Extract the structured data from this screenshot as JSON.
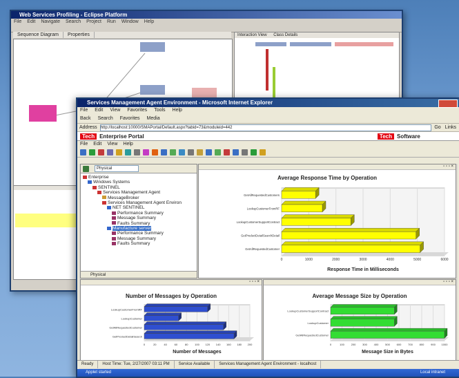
{
  "back_window": {
    "title": "Web Services Profiling - Eclipse Platform",
    "menu": [
      "File",
      "Edit",
      "Navigate",
      "Search",
      "Project",
      "Run",
      "Window",
      "Help"
    ],
    "tabs": [
      "Sequence Diagram",
      "Properties"
    ],
    "right_tabs": [
      "Interaction View",
      "Class Details"
    ]
  },
  "front_window": {
    "title": "Services Management Agent Environment - Microsoft Internet Explorer",
    "menu": [
      "File",
      "Edit",
      "View",
      "Favorites",
      "Tools",
      "Help"
    ],
    "toolbar": [
      "Back",
      "Search",
      "Favorites",
      "Media"
    ],
    "address_label": "Address",
    "address_value": "http://localhost:10000/SMAPortal/Default.aspx?tabid=73&moduleid=442",
    "go_label": "Go",
    "links_label": "Links",
    "portal_logo": "Tech",
    "portal_title": "Enterprise Portal",
    "portal_logo_right": "Tech",
    "portal_right_label": "Software",
    "portal_menu": [
      "File",
      "Edit",
      "View",
      "Help"
    ],
    "tree_select": "Physical",
    "tree": [
      {
        "label": "Enterprise",
        "indent": 0,
        "icon": "#cc3333"
      },
      {
        "label": "Windows Systems",
        "indent": 1,
        "icon": "#3366cc"
      },
      {
        "label": "SENTINEL",
        "indent": 2,
        "icon": "#cc3333"
      },
      {
        "label": "Services Management Agent",
        "indent": 3,
        "icon": "#cc3333"
      },
      {
        "label": "MessageBroker",
        "indent": 4,
        "icon": "#cc9933"
      },
      {
        "label": "Services Management Agent Environ",
        "indent": 4,
        "icon": "#cc3333"
      },
      {
        "label": "NET SENTINEL",
        "indent": 5,
        "icon": "#3366cc"
      },
      {
        "label": "Performance Summary",
        "indent": 6,
        "icon": "#993366"
      },
      {
        "label": "Message Summary",
        "indent": 6,
        "icon": "#993366"
      },
      {
        "label": "Faults Summary",
        "indent": 6,
        "icon": "#993366"
      },
      {
        "label": "Manufacture server",
        "indent": 5,
        "icon": "#3366cc",
        "highlight": true
      },
      {
        "label": "Performance Summary",
        "indent": 6,
        "icon": "#993366"
      },
      {
        "label": "Message Summary",
        "indent": 6,
        "icon": "#993366"
      },
      {
        "label": "Faults Summary",
        "indent": 6,
        "icon": "#993366"
      }
    ],
    "tree_footer": "Physical",
    "status": [
      "Ready",
      "Host Time: Tue, 2/27/2007 03:11 PM",
      "Service Available",
      "Services Management Agent Environment - localhost"
    ],
    "taskbar": "Applet started",
    "taskbar_right": "Local intranet"
  },
  "chart_data": [
    {
      "type": "bar",
      "orientation": "horizontal",
      "title": "Average Response Time by Operation",
      "xlabel": "Response Time in Milliseconds",
      "categories": [
        "GetAllRequestedCustomers",
        "LookupCustomerFromRF",
        "LookupCustomerSupportContract",
        "GetProductDetailSearchDetail",
        "GetAllRequestedCustomer"
      ],
      "values": [
        1250,
        1500,
        2550,
        4950,
        5100
      ],
      "xlim": [
        0,
        6000
      ],
      "xticks": [
        0,
        1000,
        2000,
        3000,
        4000,
        5000,
        6000
      ],
      "color": "#ffff00"
    },
    {
      "type": "bar",
      "orientation": "horizontal",
      "title": "Number of Messages by Operation",
      "xlabel": "Number of Messages",
      "categories": [
        "LookupCustomerFromRF",
        "LookupCustomer",
        "GetAllRequestedCustomer",
        "GetProductDetailSearch"
      ],
      "values": [
        120,
        65,
        150,
        170
      ],
      "xlim": [
        0,
        200
      ],
      "xticks": [
        0,
        20,
        40,
        60,
        80,
        100,
        120,
        140,
        160,
        180,
        200
      ],
      "color": "#2f4fd0"
    },
    {
      "type": "bar",
      "orientation": "horizontal",
      "title": "Average Message Size by Operation",
      "xlabel": "Message Size in Bytes",
      "categories": [
        "LookupCustomerSupportContract",
        "LookupCustomer",
        "GetAllRequestedCustomer"
      ],
      "values": [
        560,
        560,
        1000
      ],
      "xlim": [
        0,
        1000
      ],
      "xticks": [
        0,
        100,
        200,
        300,
        400,
        500,
        600,
        700,
        800,
        900,
        1000
      ],
      "color": "#33dd33"
    }
  ]
}
